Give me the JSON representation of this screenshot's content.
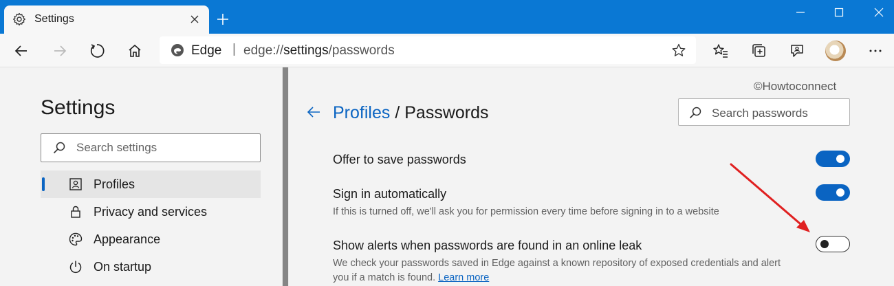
{
  "browser": {
    "tab_title": "Settings",
    "address": {
      "brand": "Edge",
      "separator": "|",
      "url_prefix": "edge://",
      "url_path": "settings",
      "url_suffix": "/passwords"
    },
    "accent_color": "#0a78d4"
  },
  "sidebar": {
    "title": "Settings",
    "search_placeholder": "Search settings",
    "items": [
      {
        "label": "Profiles",
        "icon": "profile-icon",
        "active": true
      },
      {
        "label": "Privacy and services",
        "icon": "lock-icon",
        "active": false
      },
      {
        "label": "Appearance",
        "icon": "palette-icon",
        "active": false
      },
      {
        "label": "On startup",
        "icon": "power-icon",
        "active": false
      }
    ]
  },
  "main": {
    "watermark": "©Howtoconnect",
    "breadcrumb_link": "Profiles",
    "breadcrumb_sep": "/",
    "page_title": "Passwords",
    "search_placeholder": "Search passwords",
    "settings": [
      {
        "title": "Offer to save passwords",
        "enabled": true
      },
      {
        "title": "Sign in automatically",
        "description": "If this is turned off, we'll ask you for permission every time before signing in to a website",
        "enabled": true
      },
      {
        "title": "Show alerts when passwords are found in an online leak",
        "description_line1": "We check your passwords saved in Edge against a known repository of exposed credentials and alert",
        "description_line2": "you if a match is found.",
        "learn_more": "Learn more",
        "enabled": false
      }
    ],
    "toggle_on_color": "#0a64c2",
    "annotation_color": "#e02020"
  }
}
